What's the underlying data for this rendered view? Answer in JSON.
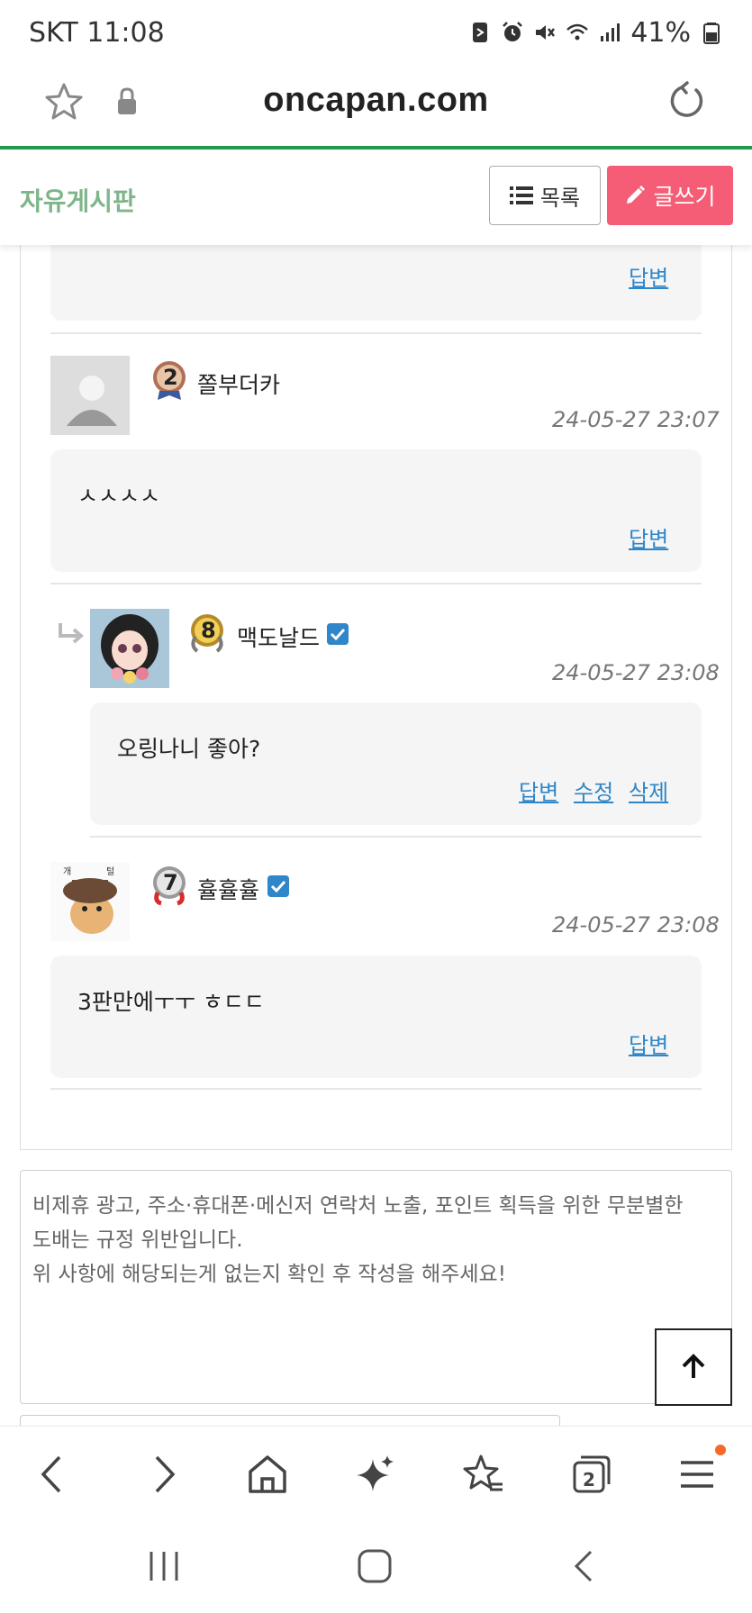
{
  "status_bar": {
    "carrier_time": "SKT 11:08",
    "battery": "41%"
  },
  "url_bar": {
    "url": "oncapan.com"
  },
  "board": {
    "title": "자유게시판",
    "list_button": "목록",
    "write_button": "글쓰기"
  },
  "comments": {
    "top_partial": {
      "reply_label": "답변"
    },
    "c1": {
      "nickname": "쫄부더카",
      "level": "2",
      "date": "24-05-27 23:07",
      "text": "ㅅㅅㅅㅅ",
      "reply_label": "답변"
    },
    "c2": {
      "nickname": "맥도날드",
      "level": "8",
      "date": "24-05-27 23:08",
      "text": "오링나니  좋아?",
      "reply_label": "답변",
      "edit_label": "수정",
      "delete_label": "삭제"
    },
    "c3": {
      "nickname": "휼휼휼",
      "level": "7",
      "date": "24-05-27 23:08",
      "text": "3판만에ㅜㅜ ㅎㄷㄷ",
      "reply_label": "답변"
    }
  },
  "comment_form": {
    "notice_line1": "비제휴 광고, 주소·휴대폰·메신저 연락처 노출, 포인트 획득을 위한 무분별한",
    "notice_line2": "도배는 규정 위반입니다.",
    "notice_line3": "위 사항에 해당되는게 없는지 확인 후 작성을 해주세요!"
  },
  "browser_nav": {
    "tab_count": "2"
  },
  "colors": {
    "accent_green": "#1f9a4b",
    "write_button": "#f45d75",
    "link_blue": "#2f86c8",
    "board_title": "#7fb58a"
  }
}
